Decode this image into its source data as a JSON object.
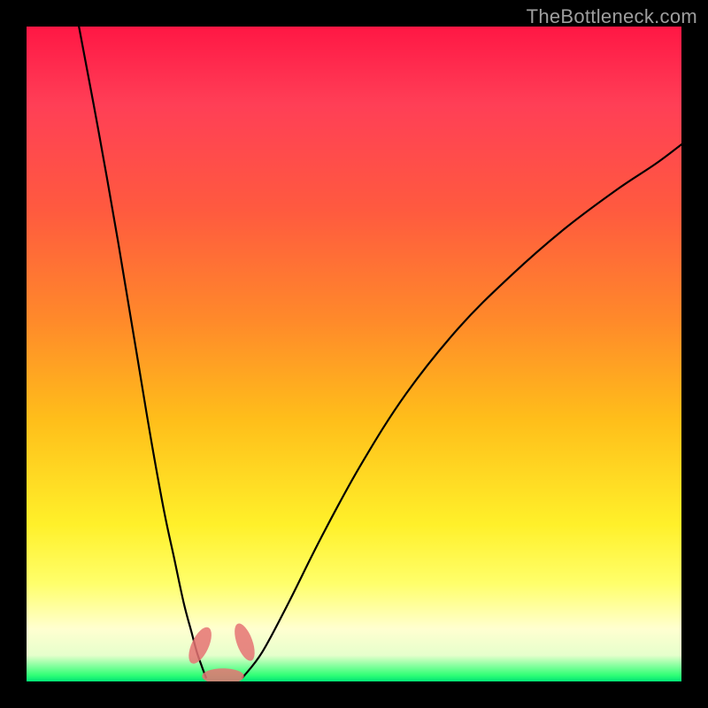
{
  "watermark": "TheBottleneck.com",
  "chart_data": {
    "type": "line",
    "title": "",
    "xlabel": "",
    "ylabel": "",
    "xlim": [
      0,
      100
    ],
    "ylim": [
      0,
      100
    ],
    "series": [
      {
        "name": "left-branch",
        "x": [
          8,
          11,
          14,
          17,
          19,
          21,
          22.5,
          24,
          25.2,
          26,
          26.8,
          27.4
        ],
        "y": [
          100,
          84,
          67,
          49,
          37,
          26,
          19,
          12,
          7.5,
          4.5,
          2.2,
          0.6
        ]
      },
      {
        "name": "right-branch",
        "x": [
          33,
          36,
          40,
          45,
          51,
          58,
          66,
          74,
          82,
          90,
          96,
          100
        ],
        "y": [
          0.6,
          4.5,
          12,
          22,
          33,
          44,
          54,
          62,
          69,
          75,
          79,
          82
        ]
      }
    ],
    "annotations": [
      {
        "name": "blob-left",
        "cx": 26.5,
        "cy": 5.5,
        "rx": 1.3,
        "ry": 3.0,
        "rot": 25
      },
      {
        "name": "blob-mid",
        "cx": 30.0,
        "cy": 0.8,
        "rx": 3.2,
        "ry": 1.2,
        "rot": 0
      },
      {
        "name": "blob-right",
        "cx": 33.3,
        "cy": 6.0,
        "rx": 1.2,
        "ry": 3.0,
        "rot": -20
      }
    ],
    "optimum_x": 30
  },
  "colors": {
    "gradient_top": "#ff1744",
    "gradient_mid": "#ffeb3b",
    "gradient_bottom": "#00e676",
    "curve": "#000000",
    "blob": "#e57373"
  }
}
